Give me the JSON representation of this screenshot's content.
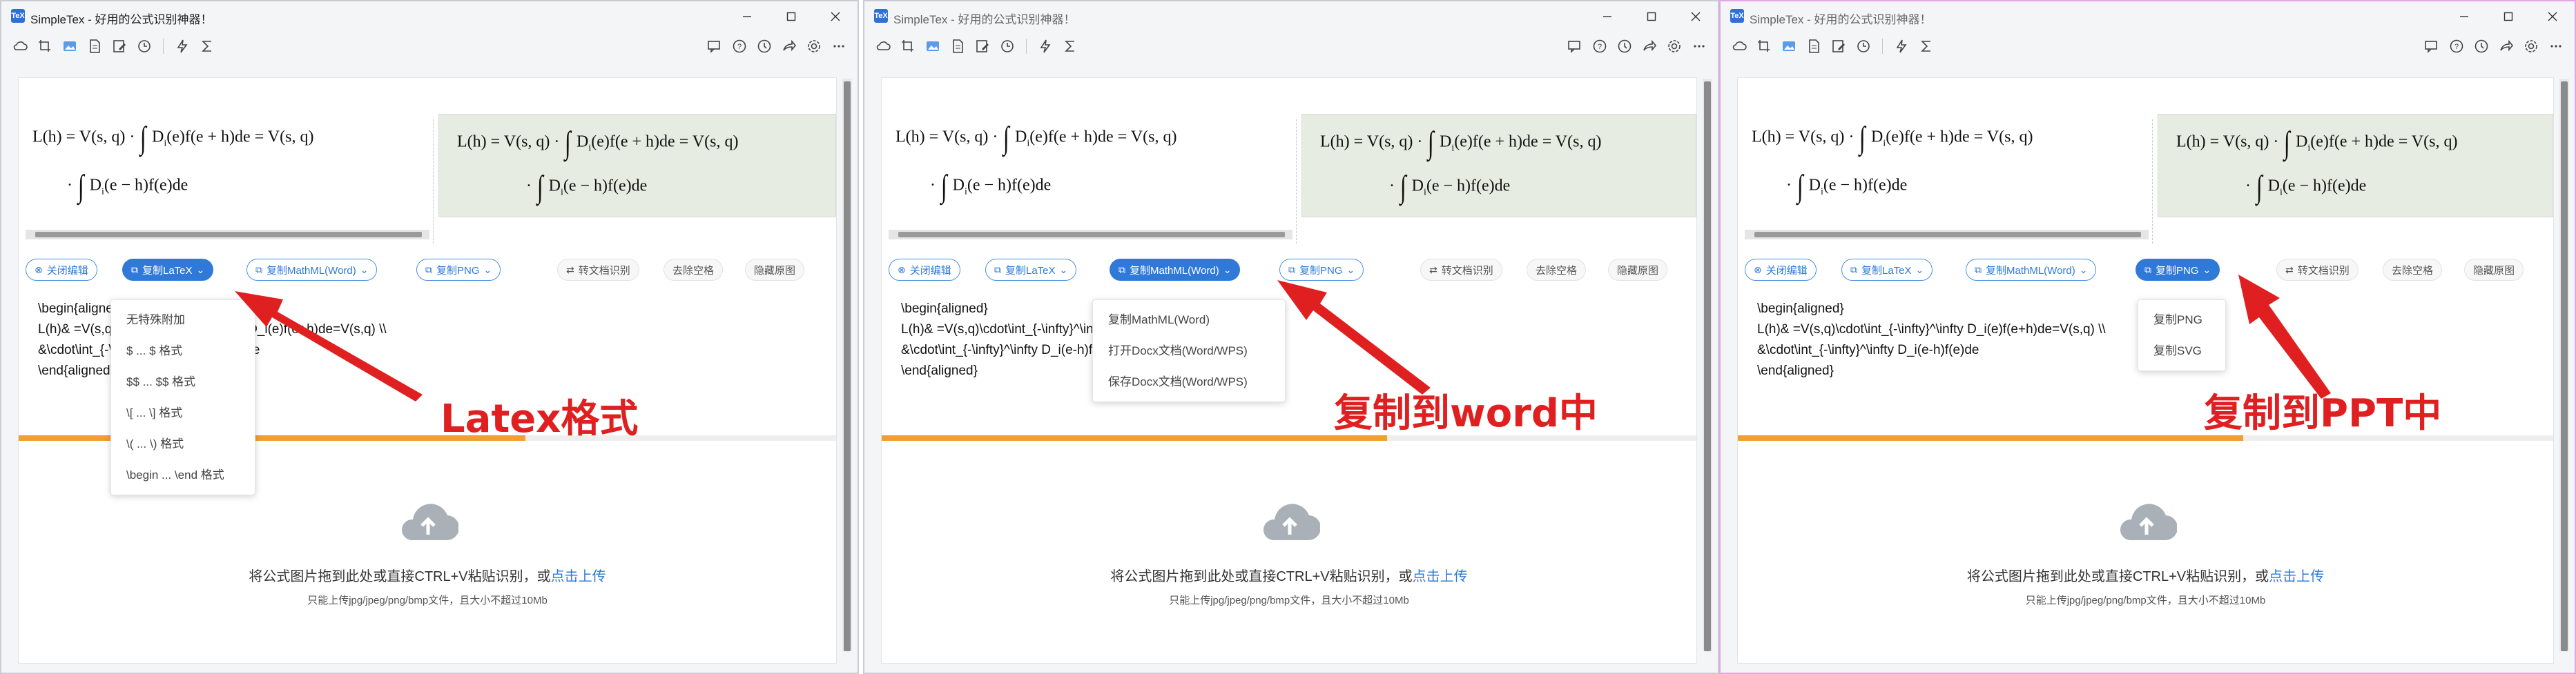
{
  "app": {
    "title": "SimpleTex - 好用的公式识别神器！",
    "logo_text": "TeX"
  },
  "toolbar": {
    "left_icons": [
      "cloud-icon",
      "crop-icon",
      "image-icon",
      "document-icon",
      "edit-icon",
      "history-icon",
      "flash-icon",
      "sigma-icon"
    ],
    "right_icons": [
      "chat-icon",
      "help-icon",
      "clock-icon",
      "share-icon",
      "settings-icon",
      "more-icon"
    ]
  },
  "latex_lines": [
    "\\begin{aligned}",
    "L(h)& =V(s,q)\\cdot\\int_{-\\infty}^\\infty D_i(e)f(e+h)de=V(s,q) \\\\",
    "&\\cdot\\int_{-\\infty}^\\infty D_i(e-h)f(e)de",
    "\\end{aligned}"
  ],
  "formula": {
    "line1_left": "L(h) = V(s, q) ·",
    "integral_upper": "∞",
    "integral_lower": "−∞",
    "line1_right": "D",
    "line1_sub": "i",
    "line1_rest": "(e)f(e + h)de = V(s, q)",
    "line2_left": "·",
    "line2_rest": "(e − h)f(e)de"
  },
  "buttons": {
    "close_edit": "关闭编辑",
    "copy_latex": "复制LaTeX",
    "copy_mathml": "复制MathML(Word)",
    "copy_png": "复制PNG",
    "to_doc": "转文档识别",
    "remove_space": "去除空格",
    "hide_original": "隐藏原图"
  },
  "upload": {
    "text": "将公式图片拖到此处或直接CTRL+V粘贴识别，或",
    "link": "点击上传",
    "sub": "只能上传jpg/jpeg/png/bmp文件，且大小不超过10Mb"
  },
  "dropdowns": {
    "latex": [
      "无特殊附加",
      "$ ... $ 格式",
      "$$ ... $$ 格式",
      "\\[ ... \\] 格式",
      "\\( ... \\) 格式",
      "\\begin ... \\end 格式"
    ],
    "word": [
      "复制MathML(Word)",
      "打开Docx文档(Word/WPS)",
      "保存Docx文档(Word/WPS)"
    ],
    "png": [
      "复制PNG",
      "复制SVG"
    ]
  },
  "callouts": {
    "latex": "Latex格式",
    "word": "复制到word中",
    "ppt": "复制到PPT中"
  },
  "progress": [
    0.62,
    0.62,
    0.62
  ],
  "colors": {
    "accent": "#2f7ad8",
    "callout": "#e02020",
    "progress": "#f0a030",
    "preview_bg": "#e6ece1"
  }
}
